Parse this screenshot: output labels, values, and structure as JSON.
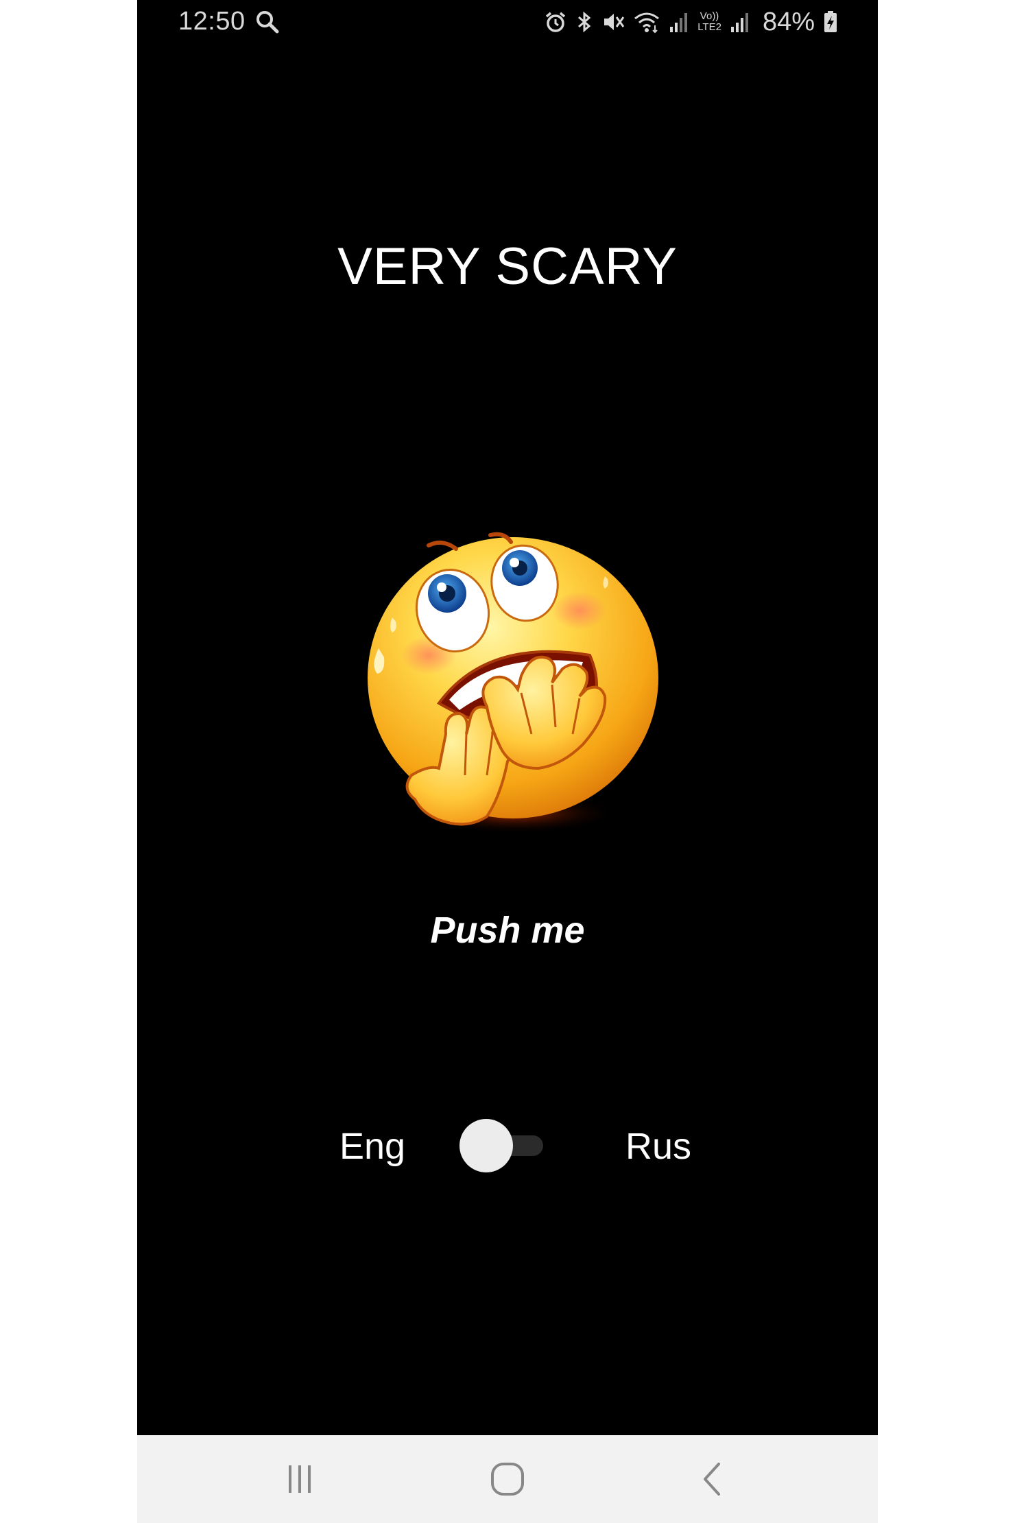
{
  "status_bar": {
    "time": "12:50",
    "battery": "84%",
    "icons": [
      "search-icon",
      "alarm-icon",
      "bluetooth-icon",
      "mute-icon",
      "wifi-icon",
      "signal-icon",
      "volte-lte2-icon",
      "signal-icon",
      "battery-charging-icon"
    ],
    "volte_line1": "Vo))",
    "volte_line2": "LTE2"
  },
  "main": {
    "title": "VERY SCARY",
    "emoji_icon": "scared-face-emoji",
    "push_label": "Push me",
    "language": {
      "left_label": "Eng",
      "right_label": "Rus",
      "toggle_on": false
    }
  },
  "nav_bar": {
    "icons": [
      "recent-apps-icon",
      "home-icon",
      "back-icon"
    ]
  },
  "colors": {
    "background": "#000000",
    "text": "#ffffff",
    "nav_background": "#f2f2f2"
  }
}
